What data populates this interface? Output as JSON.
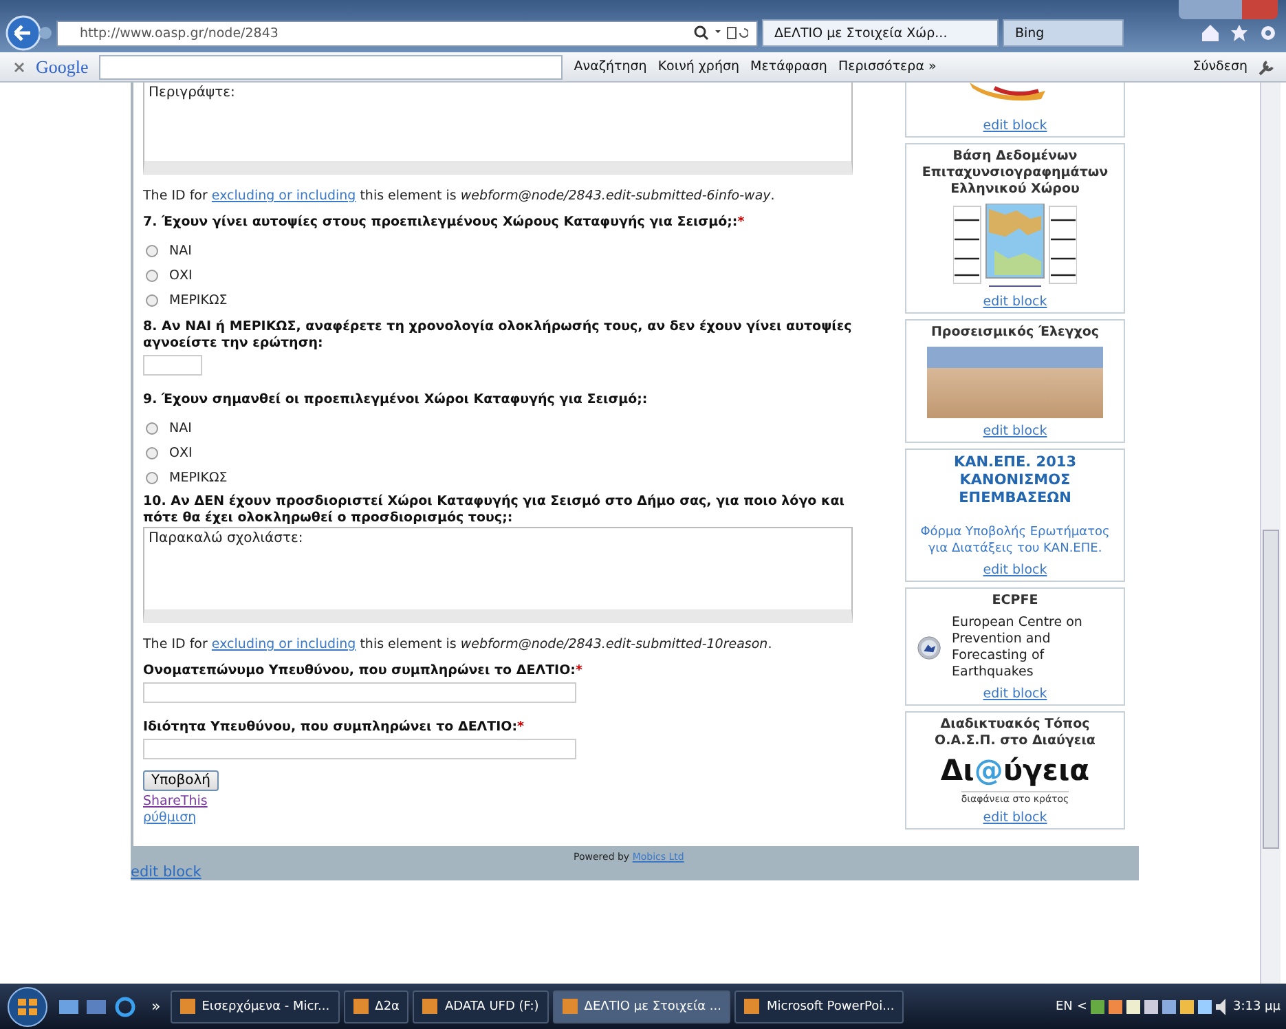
{
  "browser": {
    "url": "http://www.oasp.gr/node/2843",
    "tabs": [
      {
        "label": "ΔΕΛΤΙΟ με Στοιχεία Χώρ...",
        "selected": true
      },
      {
        "label": "Bing",
        "selected": false
      }
    ]
  },
  "google_toolbar": {
    "brand": "Google",
    "buttons": [
      "Αναζήτηση",
      "Κοινή χρήση",
      "Μετάφραση",
      "Περισσότερα »"
    ],
    "signin": "Σύνδεση"
  },
  "form": {
    "blocks": [
      {
        "kind": "textarea",
        "value": "Περιγράψτε:"
      },
      {
        "kind": "id_note",
        "prefix": "The ID for",
        "link": "excluding or including",
        "middle": "this element is",
        "id": "webform@node/2843.edit-submitted-6info-way",
        "suffix": "."
      },
      {
        "kind": "radio",
        "label": "7. Έχουν γίνει αυτοψίες στους προεπιλεγμένους Χώρους Καταφυγής για Σεισμό;:",
        "required": true,
        "options": [
          {
            "label": "ΝΑΙ",
            "selected": false
          },
          {
            "label": "ΟΧΙ",
            "selected": false
          },
          {
            "label": "ΜΕΡΙΚΩΣ",
            "selected": false
          }
        ]
      },
      {
        "kind": "short_input",
        "label": "8. Αν ΝΑΙ ή ΜΕΡΙΚΩΣ, αναφέρετε τη χρονολογία ολοκλήρωσής τους, αν δεν έχουν γίνει αυτοψίες αγνοείστε την ερώτηση:",
        "required": false
      },
      {
        "kind": "radio",
        "label": "9. Έχουν σημανθεί οι προεπιλεγμένοι Χώροι Καταφυγής για Σεισμό;:",
        "required": false,
        "options": [
          {
            "label": "ΝΑΙ",
            "selected": false
          },
          {
            "label": "ΟΧΙ",
            "selected": false
          },
          {
            "label": "ΜΕΡΙΚΩΣ",
            "selected": false
          }
        ]
      },
      {
        "kind": "textarea",
        "label": "10. Αν ΔΕΝ έχουν προσδιοριστεί Χώροι Καταφυγής για Σεισμό στο Δήμο σας, για ποιο λόγο και πότε θα έχει ολοκληρωθεί ο προσδιορισμός τους;:",
        "value": "Παρακαλώ σχολιάστε:"
      },
      {
        "kind": "id_note",
        "prefix": "The ID for",
        "link": "excluding or including",
        "middle": "this element is",
        "id": "webform@node/2843.edit-submitted-10reason",
        "suffix": "."
      },
      {
        "kind": "wide_input",
        "label": "Ονοματεπώνυμο Υπευθύνου, που συμπληρώνει το ΔΕΛΤΙΟ:",
        "required": true
      },
      {
        "kind": "wide_input",
        "label": "Ιδιότητα Υπευθύνου, που συμπληρώνει το ΔΕΛΤΙΟ:",
        "required": true
      }
    ],
    "required_mark": "*",
    "submit": "Υποβολή",
    "links": [
      "ShareThis",
      "ρύθμιση"
    ]
  },
  "footer": {
    "powered_by": "Powered by",
    "company": "Mobics Ltd",
    "edit": "edit block"
  },
  "sidebar": [
    {
      "kind": "banner",
      "edit": "edit block"
    },
    {
      "kind": "map",
      "title": "Βάση Δεδομένων Επιταχυνσιογραφημάτων Ελληνικού Χώρου",
      "edit": "edit block"
    },
    {
      "kind": "photo",
      "title": "Προσεισμικός Έλεγχος",
      "edit": "edit block"
    },
    {
      "kind": "text",
      "title": "ΚΑΝ.ΕΠΕ. 2013 ΚΑΝΟΝΙΣΜΟΣ ΕΠΕΜΒΑΣΕΩΝ",
      "text": "Φόρμα Υποβολής Ερωτήματος για Διατάξεις του ΚΑΝ.ΕΠΕ.",
      "edit": "edit block"
    },
    {
      "kind": "seal",
      "title": "ECPFE",
      "text": "European Centre on Prevention and Forecasting of Earthquakes",
      "edit": "edit block"
    },
    {
      "kind": "logo",
      "title": "Διαδικτυακός Τόπος Ο.Α.Σ.Π. στο Διαύγεια",
      "logo_parts": [
        {
          "text": "Δι",
          "color": "#111111"
        },
        {
          "text": "@",
          "color": "#3fa0dc"
        },
        {
          "text": "ύγεια",
          "color": "#111111"
        }
      ],
      "tagline": "διαφάνεια στο κράτος",
      "edit": "edit block"
    }
  ],
  "taskbar": {
    "items": [
      {
        "label": "Εισερχόμενα - Micr...",
        "selected": false
      },
      {
        "label": "Δ2α",
        "selected": false
      },
      {
        "label": "ADATA UFD (F:)",
        "selected": false
      },
      {
        "label": "ΔΕΛΤΙΟ με Στοιχεία ...",
        "selected": true
      },
      {
        "label": "Microsoft PowerPoi...",
        "selected": false
      }
    ],
    "more": "»",
    "language": "EN",
    "tray_arrow": "<",
    "time": "3:13 μμ"
  }
}
